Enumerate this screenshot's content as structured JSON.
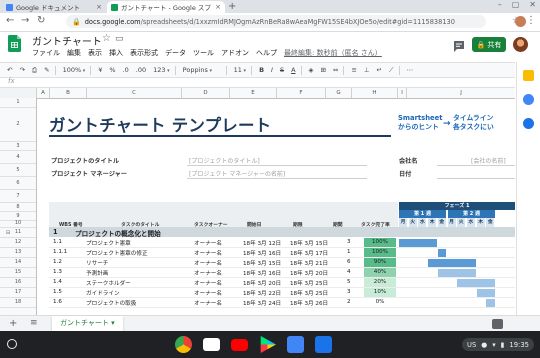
{
  "browser": {
    "tabs": [
      {
        "label": "Google ドキュメント",
        "favicon_color": "#4285f4"
      },
      {
        "label": "ガントチャート - Google スプ",
        "favicon_color": "#0f9d58"
      }
    ],
    "new_tab": "+",
    "window_controls": [
      "–",
      "▢",
      "✕"
    ],
    "url_host": "docs.google.com",
    "url_path": "/spreadsheets/d/1xxzmIdRMJOgmAzRnBeRa8wAeaMgFW15SE4bXJOe5o/edit#gid=1115838130"
  },
  "docs": {
    "title": "ガントチャート",
    "menu": [
      "ファイル",
      "編集",
      "表示",
      "挿入",
      "表示形式",
      "データ",
      "ツール",
      "アドオン",
      "ヘルプ"
    ],
    "last_edit": "最終編集: 数秒前（匿名 さん）",
    "share_label": "共有"
  },
  "toolbar": {
    "zoom": "100%",
    "currency": "¥",
    "percent": "%",
    "dec1": ".0",
    "dec2": ".00",
    "format123": "123",
    "font": "Poppins",
    "size": "11",
    "bold": "B",
    "italic": "I",
    "strike": "S",
    "textcolor": "A",
    "more": "⋯"
  },
  "grid": {
    "columns": [
      "A",
      "B",
      "C",
      "D",
      "E",
      "F",
      "G",
      "H",
      "I",
      "J"
    ],
    "rows": [
      "1",
      "2",
      "3",
      "4",
      "5",
      "6",
      "7",
      "8",
      "9",
      "10",
      "11",
      "12",
      "13",
      "14",
      "15",
      "16",
      "17",
      "18"
    ]
  },
  "sheet": {
    "title": "ガントチャート テンプレート",
    "smartsheet_line1": "Smartsheet",
    "smartsheet_line2": "からのヒント",
    "smartsheet_arrow": "→",
    "timeline_line1": "タイムライン",
    "timeline_line2": "各タスクにい",
    "project_title_label": "プロジェクトのタイトル",
    "project_title_value": "[プロジェクトのタイトル]",
    "project_manager_label": "プロジェクト マネージャー",
    "project_manager_value": "[プロジェクト マネージャーの名前]",
    "company_label": "会社名",
    "company_value": "[会社の名前]",
    "date_label": "日付",
    "headers": {
      "wbs": "WBS 番号",
      "task": "タスクのタイトル",
      "owner": "タスクオーナー",
      "start": "開始日",
      "due": "期限",
      "duration": "期間",
      "complete": "タスク完了率"
    },
    "phase": "フェーズ 1",
    "weeks": [
      "第 1 週",
      "第 2 週"
    ],
    "days": [
      "月",
      "火",
      "水",
      "木",
      "金",
      "月",
      "火",
      "水",
      "木",
      "金"
    ],
    "section": {
      "num": "1",
      "label": "プロジェクトの概念化と開始"
    },
    "tasks": [
      {
        "wbs": "1.1",
        "title": "プロジェクト憲章",
        "owner": "オーナー名",
        "start": "18年 3月 12日",
        "due": "18年 3月 15日",
        "dur": "3",
        "pct": "100%",
        "pct_value": 100
      },
      {
        "wbs": "1.1.1",
        "title": "プロジェクト憲章の修正",
        "owner": "オーナー名",
        "start": "18年 3月 16日",
        "due": "18年 3月 17日",
        "dur": "1",
        "pct": "100%",
        "pct_value": 100
      },
      {
        "wbs": "1.2",
        "title": "リサーチ",
        "owner": "オーナー名",
        "start": "18年 3月 15日",
        "due": "18年 3月 21日",
        "dur": "6",
        "pct": "90%",
        "pct_value": 90
      },
      {
        "wbs": "1.3",
        "title": "予測計画",
        "owner": "オーナー名",
        "start": "18年 3月 16日",
        "due": "18年 3月 20日",
        "dur": "4",
        "pct": "40%",
        "pct_value": 40
      },
      {
        "wbs": "1.4",
        "title": "ステークホルダー",
        "owner": "オーナー名",
        "start": "18年 3月 20日",
        "due": "18年 3月 25日",
        "dur": "5",
        "pct": "20%",
        "pct_value": 20
      },
      {
        "wbs": "1.5",
        "title": "ガイドライン",
        "owner": "オーナー名",
        "start": "18年 3月 22日",
        "due": "18年 3月 25日",
        "dur": "3",
        "pct": "10%",
        "pct_value": 10
      },
      {
        "wbs": "1.6",
        "title": "プロジェクトの取扱",
        "owner": "オーナー名",
        "start": "18年 3月 24日",
        "due": "18年 3月 26日",
        "dur": "2",
        "pct": "0%",
        "pct_value": 0
      }
    ]
  },
  "sheet_tabs": {
    "add": "+",
    "all": "≡",
    "active": "ガントチャート ▾"
  },
  "shelf": {
    "apps": [
      "chrome",
      "gmail",
      "youtube",
      "play-store",
      "docs",
      "files"
    ],
    "locale": "US",
    "time": "19:35"
  },
  "colors": {
    "accent": "#188038",
    "title": "#1f3b5c",
    "phase": "#1f4e79",
    "week": "#2e75b6"
  }
}
